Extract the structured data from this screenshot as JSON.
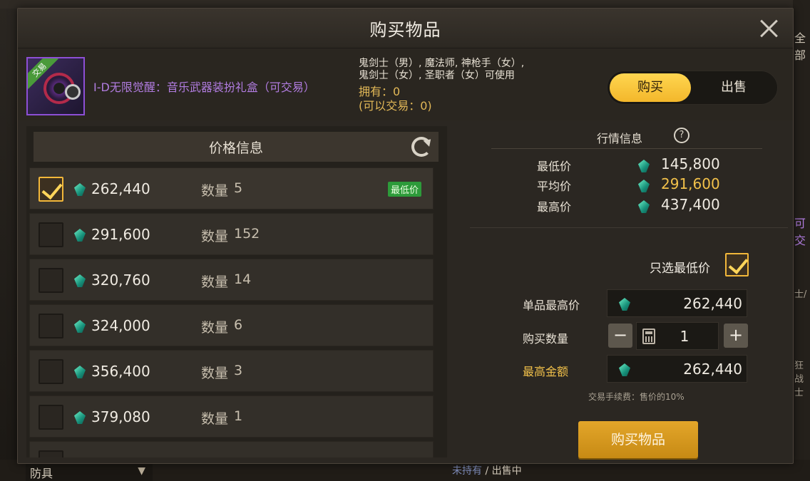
{
  "window": {
    "title": "购买物品"
  },
  "background": {
    "right_text": [
      "全部",
      "可交",
      "士/",
      "狂战士"
    ],
    "bottom_filter": "防具",
    "bottom_status_a": "未持有",
    "bottom_status_sep": " / ",
    "bottom_status_b": "出售中"
  },
  "item": {
    "name": "I-D无限觉醒：音乐武器装扮礼盒（可交易）",
    "icon_tag": "交易",
    "usable_line1": "鬼剑士（男）, 魔法师, 神枪手（女）,",
    "usable_line2": "鬼剑士（女）, 圣职者（女）可使用",
    "owned": "拥有：0",
    "tradeable": "(可以交易：0)"
  },
  "mode_toggle": {
    "buy": "购买",
    "sell": "出售",
    "selected": "buy"
  },
  "price_info": {
    "header": "价格信息",
    "qty_label": "数量",
    "lowest_badge": "最低价",
    "rows": [
      {
        "price": "262,440",
        "qty": "5",
        "checked": true,
        "lowest": true
      },
      {
        "price": "291,600",
        "qty": "152",
        "checked": false
      },
      {
        "price": "320,760",
        "qty": "14",
        "checked": false
      },
      {
        "price": "324,000",
        "qty": "6",
        "checked": false
      },
      {
        "price": "356,400",
        "qty": "3",
        "checked": false
      },
      {
        "price": "379,080",
        "qty": "1",
        "checked": false
      }
    ]
  },
  "market": {
    "title": "行情信息",
    "help_icon": "?",
    "min_label": "最低价",
    "min_value": "145,800",
    "avg_label": "平均价",
    "avg_value": "291,600",
    "max_label": "最高价",
    "max_value": "437,400"
  },
  "purchase": {
    "only_lowest_label": "只选最低价",
    "only_lowest_checked": true,
    "unit_max_label": "单品最高价",
    "unit_max_value": "262,440",
    "qty_label": "购买数量",
    "qty_value": "1",
    "total_label": "最高金额",
    "total_value": "262,440",
    "minus": "−",
    "plus": "+",
    "fee_text": "交易手续费：售价的10%",
    "buy_button": "购买物品"
  },
  "colors": {
    "accent_gold": "#f2c14a",
    "item_purple": "#b17ce0",
    "lowest_badge_green": "#2d9b3a",
    "buy_button": "#d99a1f"
  },
  "icons": [
    "close-icon",
    "refresh-icon",
    "gem-icon",
    "checkbox-checked-icon",
    "help-icon",
    "calculator-icon",
    "chevron-down-icon"
  ]
}
